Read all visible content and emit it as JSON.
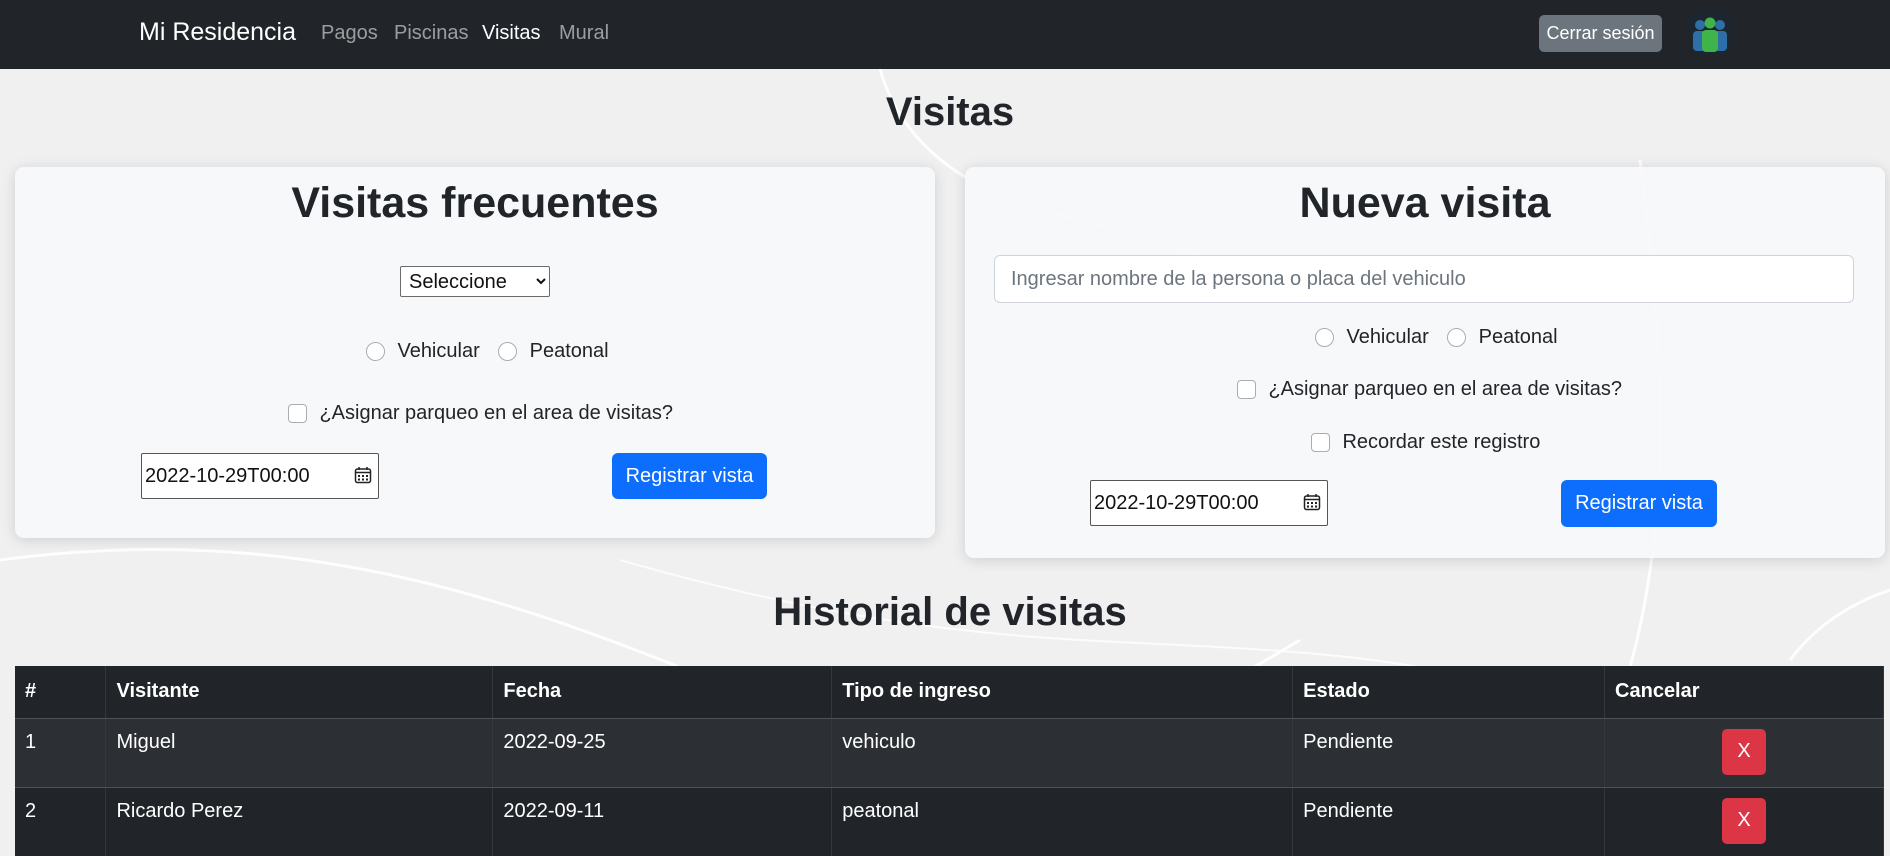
{
  "navbar": {
    "brand": "Mi Residencia",
    "links": [
      {
        "label": "Pagos",
        "active": false
      },
      {
        "label": "Piscinas",
        "active": false
      },
      {
        "label": "Visitas",
        "active": true
      },
      {
        "label": "Mural",
        "active": false
      }
    ],
    "logout_label": "Cerrar sesión",
    "avatar_icon": "users-icon"
  },
  "page": {
    "title": "Visitas"
  },
  "frequent": {
    "title": "Visitas frecuentes",
    "select_value": "Seleccione",
    "radio_vehicular": "Vehicular",
    "radio_peatonal": "Peatonal",
    "parking_label": "¿Asignar parqueo en el area de visitas?",
    "date_value": "2022-10-29T00:00",
    "submit_label": "Registrar vista"
  },
  "new_visit": {
    "title": "Nueva visita",
    "name_placeholder": "Ingresar nombre de la persona o placa del vehiculo",
    "radio_vehicular": "Vehicular",
    "radio_peatonal": "Peatonal",
    "parking_label": "¿Asignar parqueo en el area de visitas?",
    "remember_label": "Recordar este registro",
    "date_value": "2022-10-29T00:00",
    "submit_label": "Registrar vista"
  },
  "history": {
    "title": "Historial de visitas",
    "columns": [
      "#",
      "Visitante",
      "Fecha",
      "Tipo de ingreso",
      "Estado",
      "Cancelar"
    ],
    "rows": [
      {
        "num": "1",
        "visitor": "Miguel",
        "date": "2022-09-25",
        "type": "vehiculo",
        "status": "Pendiente",
        "cancel": "X"
      },
      {
        "num": "2",
        "visitor": "Ricardo Perez",
        "date": "2022-09-11",
        "type": "peatonal",
        "status": "Pendiente",
        "cancel": "X"
      }
    ]
  },
  "colors": {
    "navbar": "#212529",
    "primary": "#0d6efd",
    "danger": "#dc3545",
    "secondary": "#6c757d"
  }
}
